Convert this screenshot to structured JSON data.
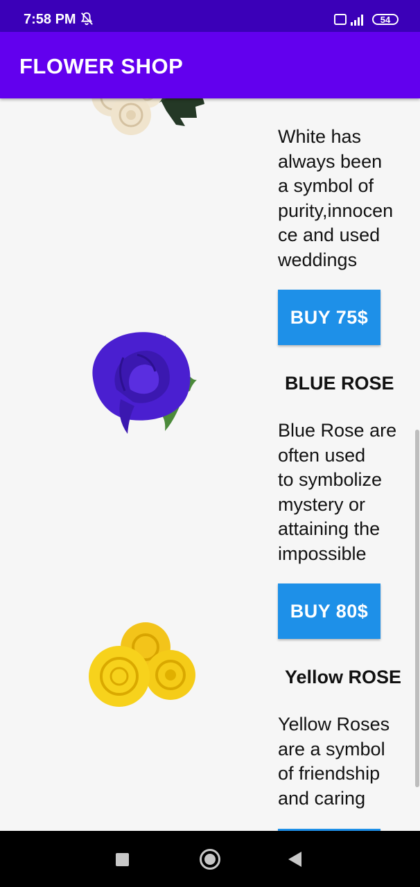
{
  "status_bar": {
    "time": "7:58 PM",
    "battery": "54",
    "volte": "VoLTE",
    "icons": [
      "bell-off-icon",
      "volte-icon",
      "signal-icon",
      "battery-icon"
    ]
  },
  "app_bar": {
    "title": "FLOWER SHOP",
    "color": "#6200ee",
    "status_color": "#3b00b8"
  },
  "flowers": [
    {
      "image": "white-rose",
      "description_lines": [
        "White has",
        "always been",
        "a symbol of",
        "purity,innocen",
        "ce and used",
        "weddings"
      ],
      "buy_label": "BUY 75$"
    },
    {
      "image": "blue-rose",
      "title": "BLUE ROSE",
      "description_lines": [
        "Blue Rose are",
        "often used",
        "to symbolize",
        "mystery or",
        "attaining the",
        "impossible"
      ],
      "buy_label": "BUY 80$"
    },
    {
      "image": "yellow-rose",
      "title": "Yellow ROSE",
      "description_lines": [
        "Yellow Roses",
        "are a symbol",
        "of friendship",
        "and caring"
      ]
    }
  ],
  "accent": {
    "button": "#1e90e8"
  },
  "nav_bar": {
    "icons": [
      "recent-apps-icon",
      "home-icon",
      "back-icon"
    ]
  }
}
